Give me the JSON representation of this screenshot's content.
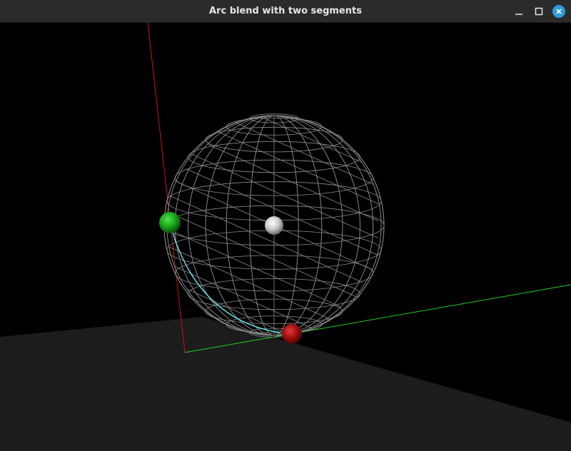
{
  "window": {
    "title": "Arc blend with two segments",
    "buttons": {
      "minimize_icon": "minimize-icon",
      "maximize_icon": "maximize-icon",
      "close_icon": "close-icon",
      "close_color": "#2d9cdb"
    }
  },
  "scene": {
    "background_color": "#000000",
    "floor_color": "#1c1c1c",
    "x_axis_color": "#cc1111",
    "y_axis_color": "#22cc22",
    "wire_sphere_color": "#8a8a8a",
    "arc_color": "#66e0ee",
    "markers": [
      {
        "name": "start-point",
        "color": "#1faa1f"
      },
      {
        "name": "center-point",
        "color": "#d8d8d8"
      },
      {
        "name": "end-point",
        "color": "#b31010"
      }
    ]
  }
}
